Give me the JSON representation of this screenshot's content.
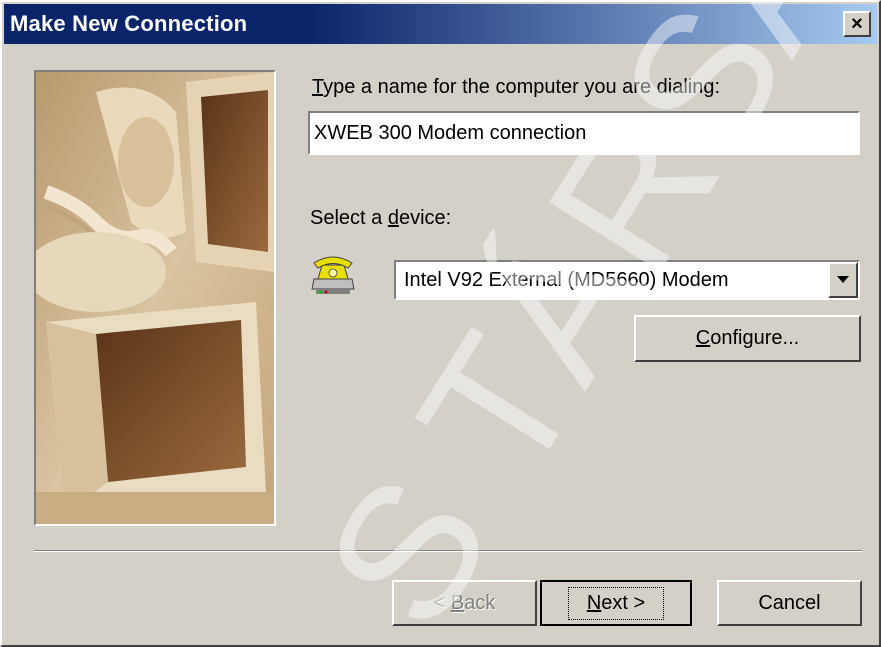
{
  "window": {
    "title": "Make New Connection",
    "close_label": "×"
  },
  "form": {
    "name_label_hotkey": "T",
    "name_label_rest": "ype a name for the computer you are dialing:",
    "name_value": "XWEB 300 Modem connection",
    "device_label_pre": "Select a ",
    "device_label_hotkey": "d",
    "device_label_rest": "evice:",
    "device_value": "Intel V92 External (MD5660) Modem",
    "device_icon": "phone-modem-icon"
  },
  "buttons": {
    "configure_hotkey": "C",
    "configure_rest": "onfigure...",
    "back_pre": "< ",
    "back_hotkey": "B",
    "back_rest": "ack",
    "next_hotkey": "N",
    "next_rest": "ext >",
    "cancel_label": "Cancel"
  },
  "watermark": {
    "text": "S TÁRSA ZR"
  },
  "colors": {
    "titlebar_start": "#0a246a",
    "titlebar_end": "#a6caf0",
    "face": "#d4d0c8"
  }
}
